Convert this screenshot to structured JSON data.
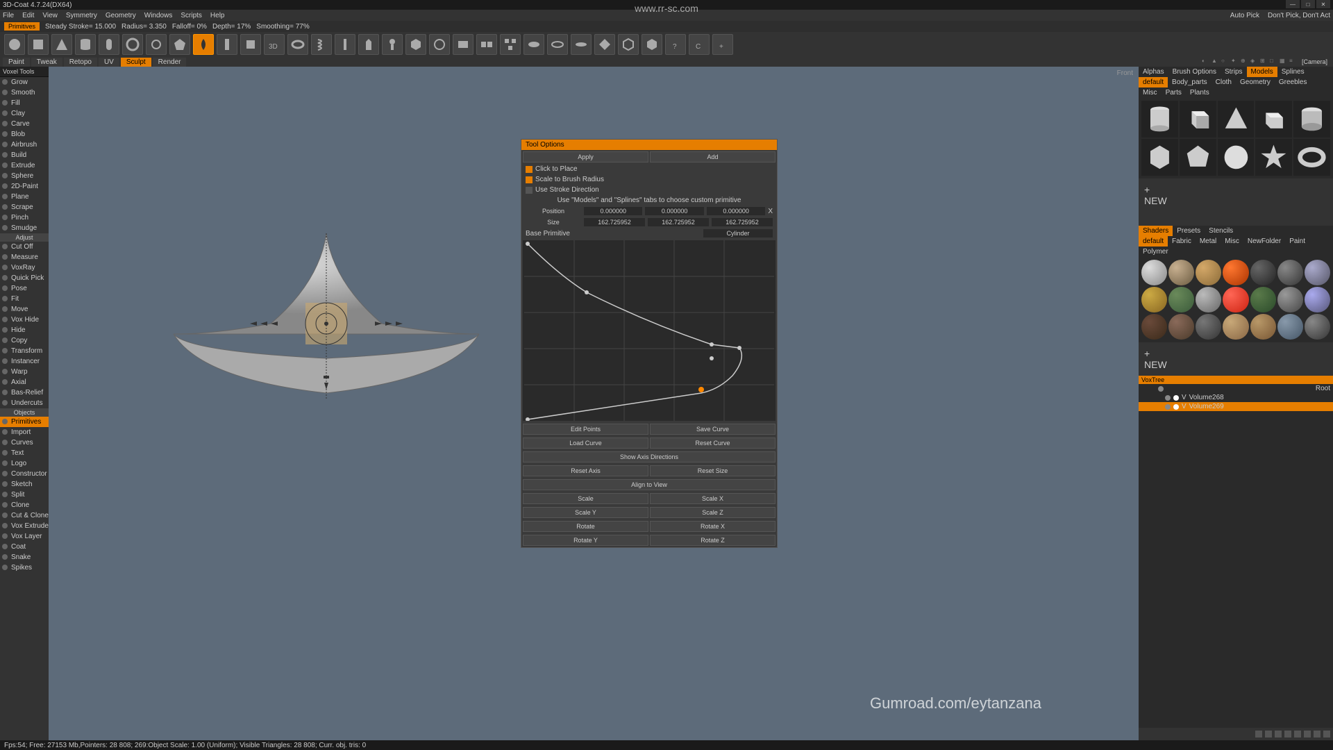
{
  "app": {
    "title": "3D-Coat 4.7.24(DX64)"
  },
  "menu": [
    "File",
    "Edit",
    "View",
    "Symmetry",
    "Geometry",
    "Windows",
    "Scripts",
    "Help"
  ],
  "menu_right": [
    "Auto Pick",
    "Don't Pick, Don't Act"
  ],
  "optbar": {
    "primitives": "Primitives",
    "stroke": "Steady Stroke= 15.000",
    "radius": "Radius= 3.350",
    "falloff": "Falloff= 0%",
    "depth": "Depth= 17%",
    "smooth": "Smoothing= 77%"
  },
  "rooms": [
    "Paint",
    "Tweak",
    "Retopo",
    "UV",
    "Sculpt",
    "Render"
  ],
  "rooms_active": 4,
  "left": {
    "header": "Voxel Tools",
    "items": [
      "Grow",
      "Smooth",
      "Fill",
      "Clay",
      "Carve",
      "Blob",
      "Airbrush",
      "Build",
      "Extrude",
      "Sphere",
      "2D-Paint",
      "Plane",
      "Scrape",
      "Pinch",
      "Smudge"
    ],
    "adjust_header": "Adjust",
    "adjust": [
      "Cut Off",
      "Measure",
      "VoxRay",
      "Quick Pick",
      "Pose",
      "Fit",
      "Move",
      "Vox Hide",
      "Hide",
      "Copy",
      "Transform",
      "Instancer",
      "Warp",
      "Axial",
      "Bas-Relief",
      "Undercuts"
    ],
    "objects_header": "Objects",
    "objects": [
      "Primitives",
      "Import",
      "Curves",
      "Text",
      "Logo",
      "Constructor",
      "Sketch",
      "Split",
      "Clone",
      "Cut & Clone",
      "Vox Extrude",
      "Vox Layer",
      "Coat",
      "Snake",
      "Spikes"
    ],
    "objects_active": 0
  },
  "viewport": {
    "label": "Front",
    "camera": "[Camera]"
  },
  "tool_options": {
    "title": "Tool Options",
    "apply": "Apply",
    "add": "Add",
    "click": "Click to Place",
    "scale": "Scale to Brush Radius",
    "stroke": "Use Stroke Direction",
    "hint": "Use \"Models\" and \"Splines\" tabs to choose custom primitive",
    "pos_label": "Position",
    "size_label": "Size",
    "pos": [
      "0.000000",
      "0.000000",
      "0.000000"
    ],
    "size": [
      "162.725952",
      "162.725952",
      "162.725952"
    ],
    "base": "Base Primitive",
    "base_val": "Cylinder",
    "edit_points": "Edit Points",
    "save_curve": "Save Curve",
    "load_curve": "Load Curve",
    "reset_curve": "Reset Curve",
    "show_axis": "Show Axis Directions",
    "reset_axis": "Reset Axis",
    "reset_size": "Reset Size",
    "align": "Align to View",
    "scale_btn": "Scale",
    "scalex": "Scale X",
    "scaley": "Scale Y",
    "scalez": "Scale Z",
    "rotate": "Rotate",
    "rotx": "Rotate X",
    "roty": "Rotate Y",
    "rotz": "Rotate Z"
  },
  "right": {
    "top_tabs": [
      "Alphas",
      "Brush Options",
      "Strips",
      "Models",
      "Splines"
    ],
    "top_active": 3,
    "sub_tabs": [
      "default",
      "Body_parts",
      "Cloth",
      "Geometry",
      "Greebles",
      "Misc",
      "Parts",
      "Plants"
    ],
    "sub_active": 0,
    "shader_tabs": [
      "Shaders",
      "Presets",
      "Stencils"
    ],
    "shader_active": 0,
    "shader_sub": [
      "default",
      "Fabric",
      "Metal",
      "Misc",
      "NewFolder",
      "Paint",
      "Polymer"
    ],
    "shader_sub_active": 0,
    "voxtree": "VoxTree",
    "root": "Root",
    "vol1": "Volume268",
    "vol2": "Volume269",
    "new": "NEW"
  },
  "status": {
    "text": "Fps:54;    Free: 27153 Mb,Pointers: 28 808; 269:Object Scale: 1.00 (Uniform); Visible Triangles: 28 808; Curr. obj. tris: 0"
  },
  "watermark": "Gumroad.com/eytanzana",
  "url": "www.rr-sc.com"
}
